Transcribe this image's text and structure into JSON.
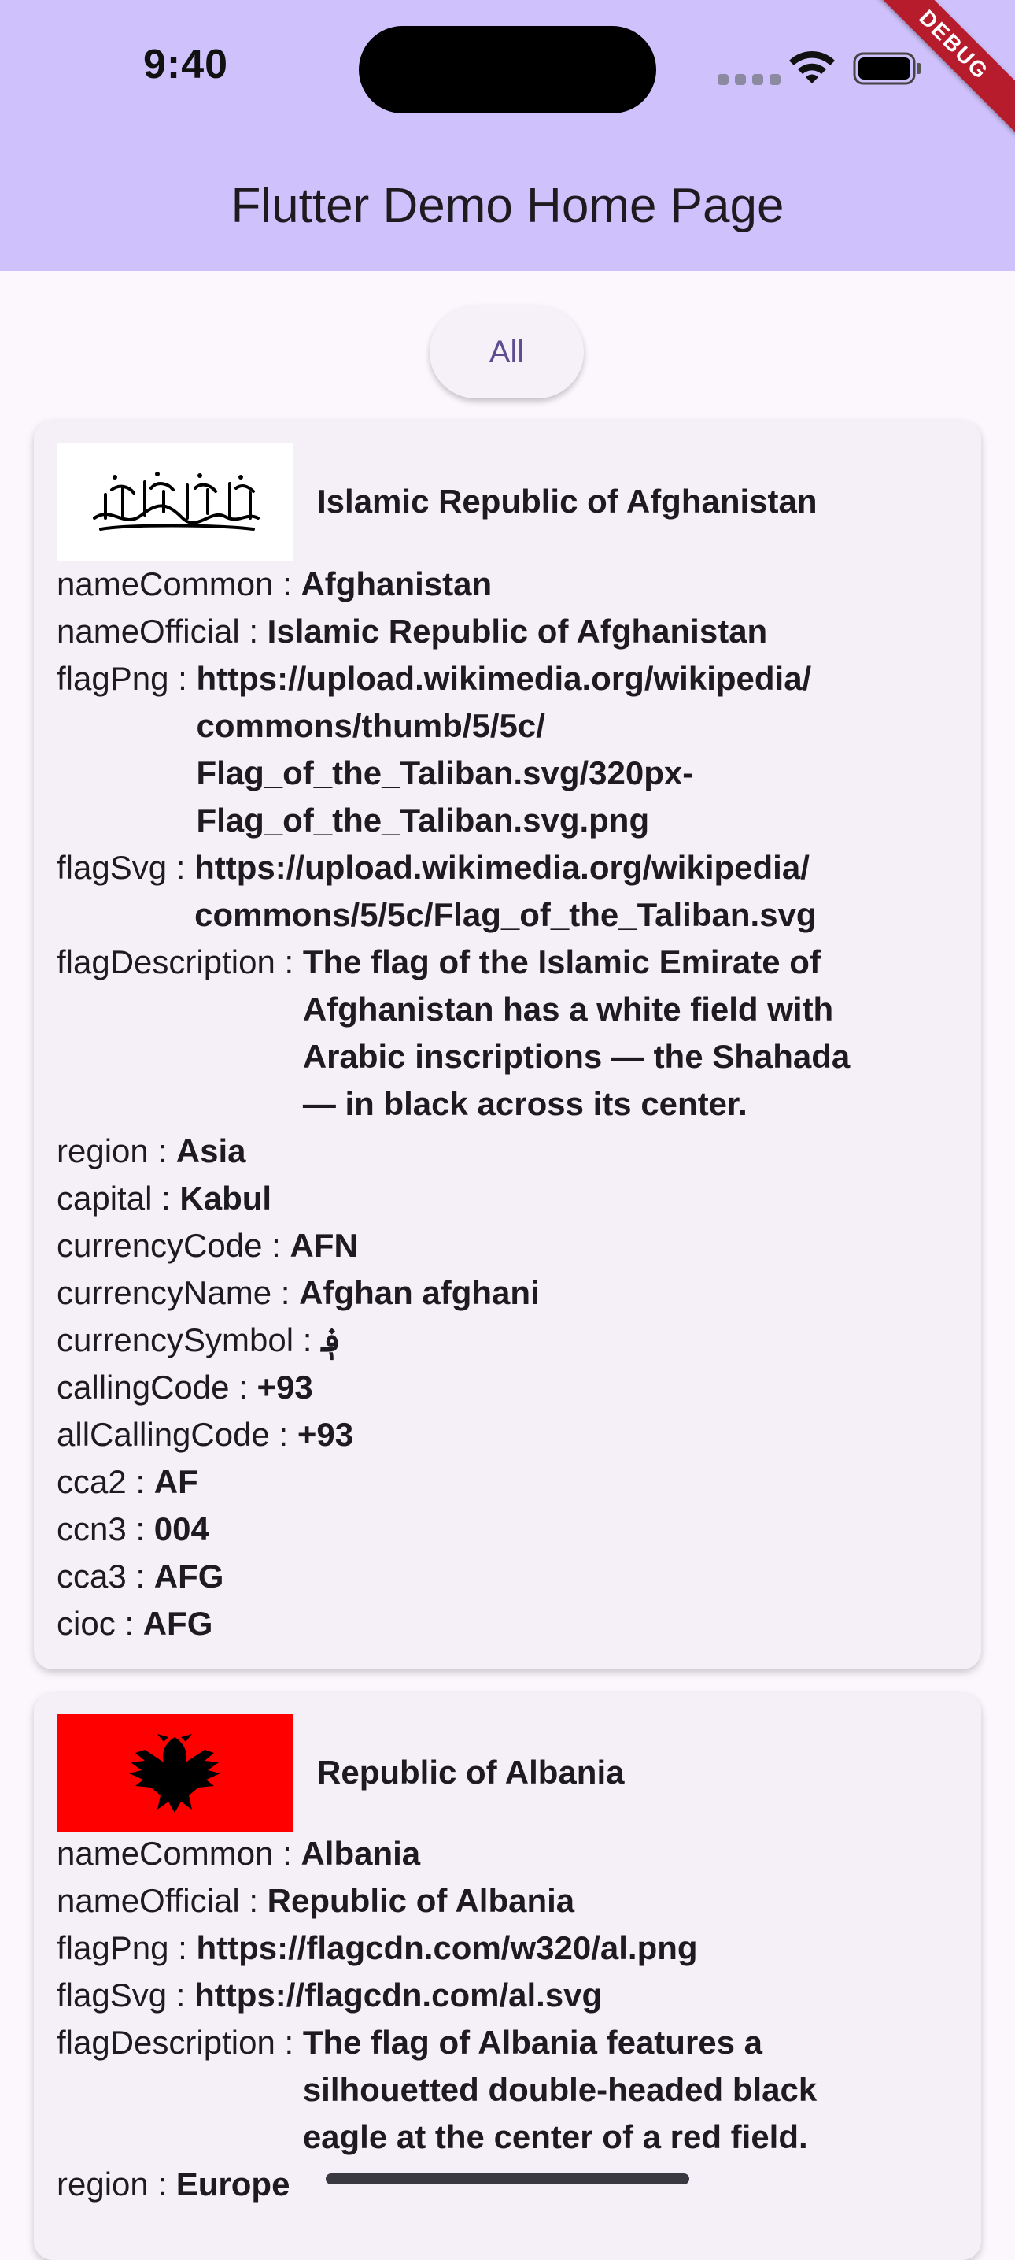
{
  "status": {
    "time": "9:40",
    "debug_label": "DEBUG"
  },
  "appbar": {
    "title": "Flutter Demo Home Page",
    "color": "#cfc2fc"
  },
  "filter": {
    "label": "All"
  },
  "countries": [
    {
      "title": "Islamic Republic of Afghanistan",
      "flag_icon": "flag-afghanistan-icon",
      "fields": {
        "nameCommon": {
          "label": "nameCommon : ",
          "value": "Afghanistan"
        },
        "nameOfficial": {
          "label": "nameOfficial : ",
          "value": "Islamic Republic of Afghanistan"
        },
        "flagPng": {
          "label": "flagPng : ",
          "lines": [
            "https://upload.wikimedia.org/wikipedia/",
            "commons/thumb/5/5c/",
            "Flag_of_the_Taliban.svg/320px-",
            "Flag_of_the_Taliban.svg.png"
          ]
        },
        "flagSvg": {
          "label": "flagSvg : ",
          "lines": [
            "https://upload.wikimedia.org/wikipedia/",
            "commons/5/5c/Flag_of_the_Taliban.svg"
          ]
        },
        "flagDescription": {
          "label": "flagDescription : ",
          "lines": [
            "The flag of the Islamic Emirate of",
            "Afghanistan has a white field with",
            "Arabic inscriptions — the Shahada",
            "— in black across its center."
          ]
        },
        "region": {
          "label": "region : ",
          "value": "Asia"
        },
        "capital": {
          "label": "capital : ",
          "value": "Kabul"
        },
        "currencyCode": {
          "label": "currencyCode : ",
          "value": "AFN"
        },
        "currencyName": {
          "label": "currencyName : ",
          "value": "Afghan afghani"
        },
        "currencySymbol": {
          "label": "currencySymbol : ",
          "value": "؋"
        },
        "callingCode": {
          "label": "callingCode : ",
          "value": "+93"
        },
        "allCallingCode": {
          "label": "allCallingCode : ",
          "value": "+93"
        },
        "cca2": {
          "label": "cca2 : ",
          "value": "AF"
        },
        "ccn3": {
          "label": "ccn3 : ",
          "value": "004"
        },
        "cca3": {
          "label": "cca3 : ",
          "value": "AFG"
        },
        "cioc": {
          "label": "cioc : ",
          "value": "AFG"
        }
      }
    },
    {
      "title": "Republic of Albania",
      "flag_icon": "flag-albania-icon",
      "fields": {
        "nameCommon": {
          "label": "nameCommon : ",
          "value": "Albania"
        },
        "nameOfficial": {
          "label": "nameOfficial : ",
          "value": "Republic of Albania"
        },
        "flagPng": {
          "label": "flagPng : ",
          "value": "https://flagcdn.com/w320/al.png"
        },
        "flagSvg": {
          "label": "flagSvg : ",
          "value": "https://flagcdn.com/al.svg"
        },
        "flagDescription": {
          "label": "flagDescription : ",
          "lines": [
            "The flag of Albania features a",
            "silhouetted double-headed black",
            "eagle at the center of a red field."
          ]
        },
        "region": {
          "label": "region : ",
          "value": "Europe"
        }
      }
    }
  ]
}
